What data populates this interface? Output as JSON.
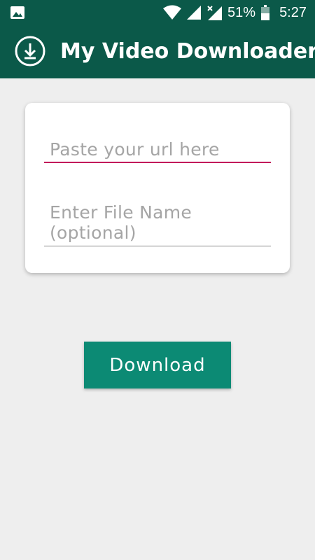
{
  "status_bar": {
    "battery_percent": "51%",
    "time": "5:27",
    "icons": [
      "image-notification-icon",
      "wifi-icon",
      "signal-icon",
      "signal-no-data-icon",
      "battery-icon"
    ]
  },
  "app_bar": {
    "title": "My Video Downloader",
    "icon": "download-icon",
    "color": "#0b5949"
  },
  "form": {
    "url_placeholder": "Paste your url here",
    "filename_placeholder": "Enter File Name (optional)",
    "url_underline_color": "#c2185b"
  },
  "actions": {
    "download_label": "Download",
    "download_color": "#0c8a74"
  }
}
